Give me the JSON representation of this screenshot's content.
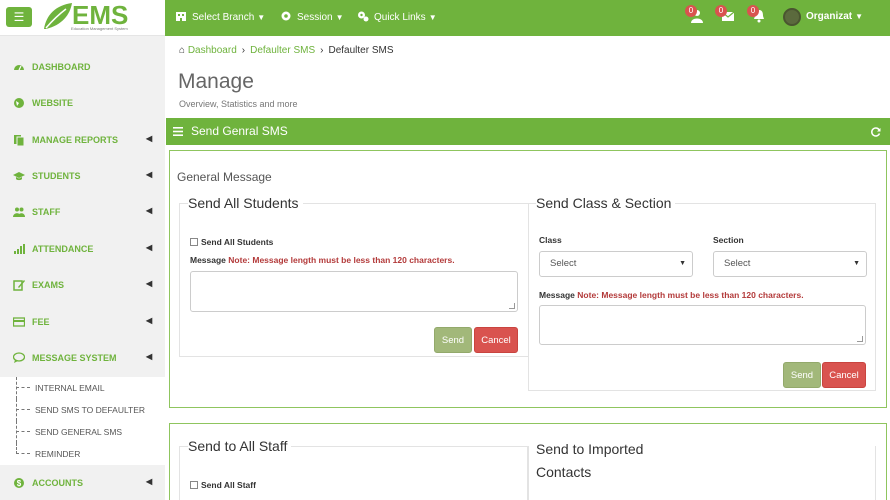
{
  "brand": {
    "name": "EMS",
    "tagline": "Education Management System",
    "color": "#6fb33d"
  },
  "topbar": {
    "menu_icon": "hamburger-icon",
    "nav": [
      {
        "label": "Select Branch",
        "icon": "building-icon"
      },
      {
        "label": "Session",
        "icon": "gear-icon"
      },
      {
        "label": "Quick Links",
        "icon": "gears-icon"
      }
    ],
    "notifications": [
      {
        "icon": "user-icon",
        "count": "0"
      },
      {
        "icon": "envelope-icon",
        "count": "0"
      },
      {
        "icon": "bell-icon",
        "count": "0"
      }
    ],
    "user_name": "Organizat"
  },
  "sidebar": {
    "items": [
      {
        "label": "DASHBOARD",
        "icon": "dashboard-icon",
        "has_arrow": false
      },
      {
        "label": "WEBSITE",
        "icon": "globe-icon",
        "has_arrow": false
      },
      {
        "label": "MANAGE REPORTS",
        "icon": "files-icon",
        "has_arrow": true
      },
      {
        "label": "STUDENTS",
        "icon": "graduation-cap-icon",
        "has_arrow": true
      },
      {
        "label": "STAFF",
        "icon": "users-icon",
        "has_arrow": true
      },
      {
        "label": "ATTENDANCE",
        "icon": "signal-icon",
        "has_arrow": true
      },
      {
        "label": "EXAMS",
        "icon": "edit-icon",
        "has_arrow": true
      },
      {
        "label": "FEE",
        "icon": "credit-card-icon",
        "has_arrow": true
      },
      {
        "label": "MESSAGE SYSTEM",
        "icon": "comment-icon",
        "has_arrow": true
      },
      {
        "label": "ACCOUNTS",
        "icon": "money-icon",
        "has_arrow": true
      }
    ],
    "submenu": [
      {
        "label": "INTERNAL EMAIL"
      },
      {
        "label": "SEND SMS TO DEFAULTER"
      },
      {
        "label": "SEND GENERAL SMS"
      },
      {
        "label": "REMINDER"
      }
    ]
  },
  "breadcrumb": {
    "home": "Dashboard",
    "parent": "Defaulter SMS",
    "current": "Defaulter SMS"
  },
  "page": {
    "title": "Manage",
    "subtitle": "Overview, Statistics and more"
  },
  "panel": {
    "title": "Send Genral SMS",
    "refresh_icon": "refresh-icon"
  },
  "general_message": {
    "title": "General Message",
    "all_students": {
      "legend": "Send All Students",
      "checkbox_label": "Send All Students",
      "message_label": "Message",
      "note": "Note: Message length must be less than 120 characters.",
      "send": "Send",
      "cancel": "Cancel"
    },
    "class_section": {
      "legend": "Send Class & Section",
      "class_label": "Class",
      "class_value": "Select",
      "section_label": "Section",
      "section_value": "Select",
      "message_label": "Message",
      "note": "Note: Message length must be less than 120 characters.",
      "send": "Send",
      "cancel": "Cancel"
    }
  },
  "staff": {
    "legend": "Send to All Staff",
    "checkbox_label": "Send All Staff"
  },
  "imported": {
    "legend_line1": "Send to Imported",
    "legend_line2": "Contacts"
  }
}
